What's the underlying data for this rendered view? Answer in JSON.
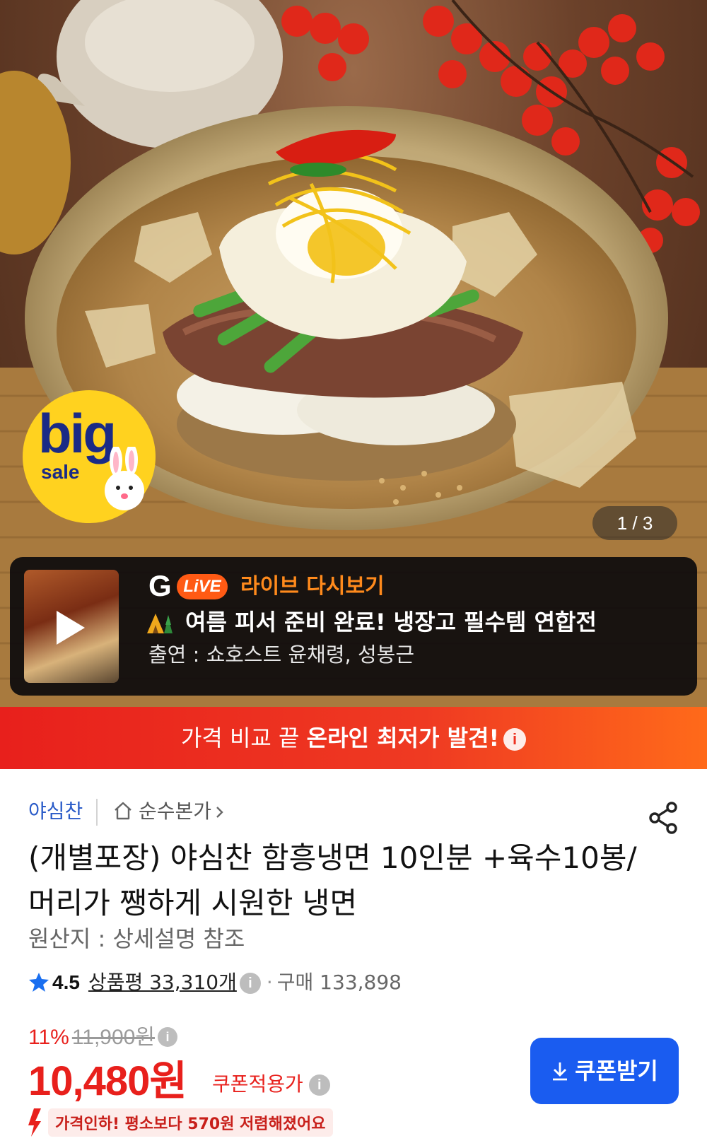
{
  "hero": {
    "badge": {
      "big": "big",
      "sale": "sale"
    },
    "counter": "1 / 3"
  },
  "live": {
    "brand_g": "G",
    "brand_live": "LiVE",
    "replay_label": "라이브 다시보기",
    "title": "여름 피서 준비 완료! 냉장고 필수템 연합전",
    "cast": "출연 : 쇼호스트 윤채령, 성봉근"
  },
  "compare_bar": {
    "prefix": "가격 비교 끝",
    "highlight": "온라인 최저가 발견!",
    "info": "i"
  },
  "product": {
    "brand": "야심찬",
    "store": "순수본가",
    "title": "(개별포장) 야심찬 함흥냉면 10인분 +육수10봉/ 머리가 쨍하게 시원한 냉면",
    "origin": "원산지 : 상세설명 참조",
    "rating": "4.5",
    "reviews": "상품평 33,310개",
    "purchases": "구매 133,898",
    "discount_rate": "11%",
    "original_price": "11,900원",
    "price": "10,480원",
    "coupon_note": "쿠폰적용가",
    "coupon_button": "쿠폰받기",
    "price_drop_message": "가격인하! 평소보다 570원 저렴해졌어요"
  },
  "colors": {
    "accent_red": "#e8201c",
    "brand_blue": "#2a5bc8",
    "button_blue": "#1a5cf0",
    "live_orange": "#ff8a1c",
    "badge_yellow": "#ffd21f"
  },
  "icons": [
    "play-icon",
    "tent-icon",
    "info-icon",
    "home-icon",
    "share-icon",
    "star-icon",
    "download-icon",
    "price-drop-arrow-icon"
  ]
}
